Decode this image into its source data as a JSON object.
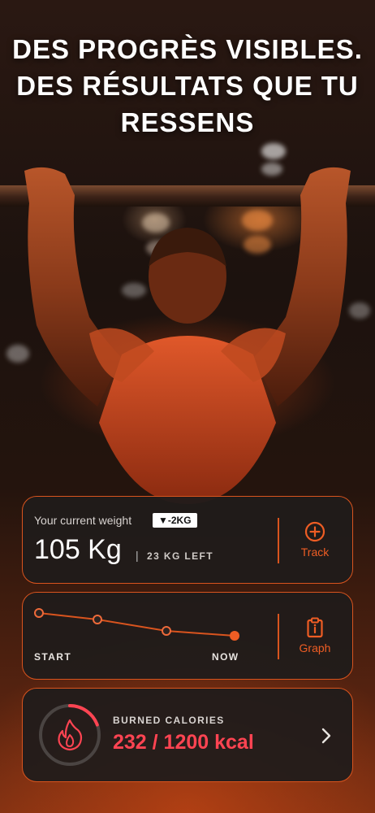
{
  "headline": "DES PROGRÈS VISIBLES. DES RÉSULTATS QUE TU RESSENS",
  "weight_card": {
    "label": "Your current weight",
    "change_badge": "▼-2KG",
    "value": "105 Kg",
    "separator": "|",
    "remaining": "23 KG LEFT",
    "action_label": "Track",
    "action_icon": "plus-circle-icon"
  },
  "graph_card": {
    "start_label": "START",
    "end_label": "NOW",
    "action_label": "Graph",
    "action_icon": "clipboard-chart-icon"
  },
  "calories_card": {
    "label": "BURNED CALORIES",
    "value": "232 / 1200 kcal",
    "burned": 232,
    "goal": 1200,
    "icon": "flame-icon",
    "chevron_icon": "chevron-right-icon"
  },
  "colors": {
    "accent": "#d9541e",
    "accent_text": "#ee5d24",
    "calorie_red": "#ff4452",
    "card_bg": "#201c1b"
  }
}
